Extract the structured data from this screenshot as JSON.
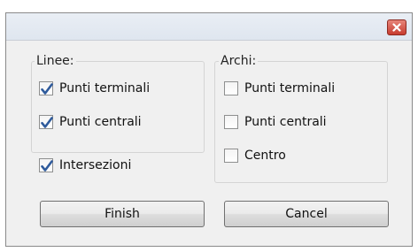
{
  "titlebar": {
    "close_icon": "close-icon"
  },
  "linee": {
    "label": "Linee:",
    "items": [
      {
        "label": "Punti terminali",
        "checked": true
      },
      {
        "label": "Punti centrali",
        "checked": true
      }
    ]
  },
  "intersezioni": {
    "label": "Intersezioni",
    "checked": true
  },
  "archi": {
    "label": "Archi:",
    "items": [
      {
        "label": "Punti terminali",
        "checked": false
      },
      {
        "label": "Punti centrali",
        "checked": false
      },
      {
        "label": "Centro",
        "checked": false
      }
    ]
  },
  "buttons": {
    "finish": "Finish",
    "cancel": "Cancel"
  },
  "colors": {
    "check": "#2f5b9c",
    "close": "#c73c2f"
  }
}
